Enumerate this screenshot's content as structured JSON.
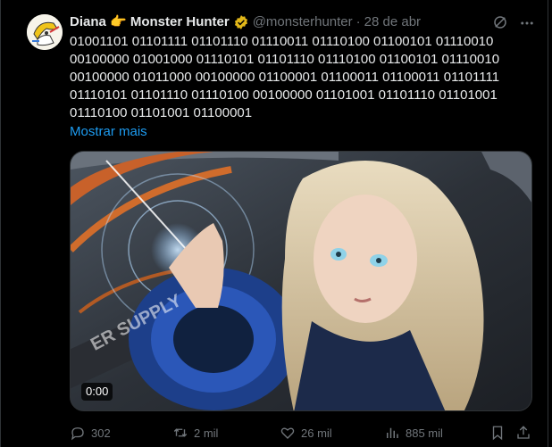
{
  "tweet": {
    "display_name": "Diana 👉 Monster Hunter",
    "handle": "@monsterhunter",
    "separator": "·",
    "date": "28 de abr",
    "text_lines": [
      "01001101 01101111 01101110 01110011 01110100 01100101 01110010",
      "00100000 01001000 01110101 01101110 01110100 01100101 01110010",
      "00100000 01011000 00100000 01100001 01100011 01100011 01101111",
      "01110101 01101110 01110100 00100000 01101001 01101110 01101001",
      "01110100 01101001 01100001"
    ],
    "show_more_label": "Mostrar mais",
    "video_time": "0:00",
    "video_overlay_text": "ER SUPPLY"
  },
  "actions": {
    "reply_count": "302",
    "retweet_count": "2 mil",
    "like_count": "26 mil",
    "views_count": "885 mil"
  },
  "icons": {
    "verified": "verified-gold-badge-icon",
    "grok": "grok-icon",
    "more": "more-icon",
    "reply": "reply-icon",
    "retweet": "retweet-icon",
    "like": "heart-icon",
    "views": "views-icon",
    "bookmark": "bookmark-icon",
    "share": "share-icon"
  },
  "colors": {
    "background": "#000000",
    "text": "#e7e9ea",
    "muted": "#71767b",
    "link": "#1d9bf0",
    "verified_gold": "#e2b719"
  }
}
